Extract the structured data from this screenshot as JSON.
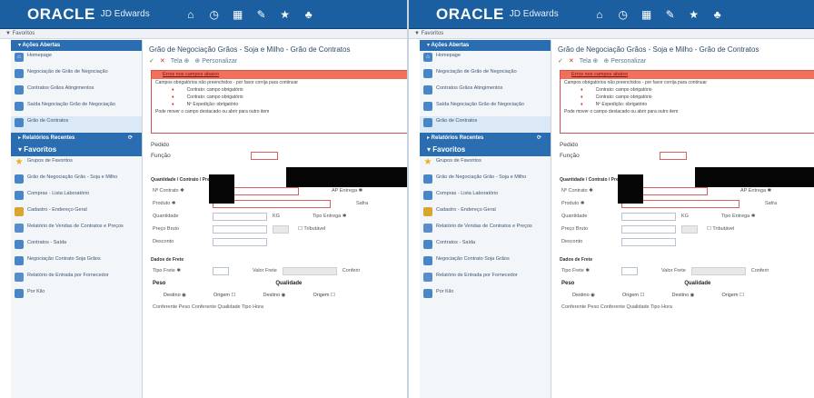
{
  "header": {
    "logo": "ORACLE",
    "logo_sub": "JD Edwards",
    "icons": [
      "home-icon",
      "clock-icon",
      "report-icon",
      "edit-icon",
      "star-icon",
      "bell-icon"
    ]
  },
  "favbar": {
    "label": "▼ Favoritos"
  },
  "sidebar": {
    "section_open": "▾ Ações Abertas",
    "open_items": [
      {
        "label": "Homepage",
        "icon": "home-icon"
      },
      {
        "label": "Negociação de Grão de Negociação",
        "icon": "app-icon"
      },
      {
        "label": "Contratos Grãos Atingimentos",
        "icon": "app-icon"
      },
      {
        "label": "Saída Negociação Grão de Negociação",
        "icon": "app-icon"
      },
      {
        "label": "Grão de Contratos",
        "icon": "app-icon",
        "active": true
      }
    ],
    "section_recent": "▸ Relatórios Recentes",
    "section_fav": "▾ Favoritos",
    "fav_items": [
      {
        "label": "Grupos de Favoritos",
        "icon": "star-icon"
      },
      {
        "label": "Grão de Negociação Grão - Soja e Milho",
        "icon": "app-icon"
      },
      {
        "label": "Compras - Lista Laboratório",
        "icon": "app-icon"
      },
      {
        "label": "Cadastro - Endereço Geral",
        "icon": "people-icon"
      },
      {
        "label": "Relatório de Vendas de Contratos e Preços",
        "icon": "doc-icon"
      },
      {
        "label": "Contratos - Saída",
        "icon": "app-icon"
      },
      {
        "label": "Negociação Contrato Soja Grãos",
        "icon": "app-icon"
      },
      {
        "label": "Relatório de Entrada por Fornecedor",
        "icon": "doc-icon"
      },
      {
        "label": "Por Kilo",
        "icon": "app-icon"
      }
    ]
  },
  "main": {
    "title": "Grão de Negociação Grãos - Soja e Milho - Grão de Contratos",
    "toolbar": {
      "ok": "✓",
      "cancel": "✕",
      "find": "Tela ⊕",
      "personalize": "⊕ Personalizar"
    },
    "error_box": {
      "head": "Erros nos campos abaixo",
      "intro": "Campos obrigatórios não preenchidos - por favor corrija para continuar",
      "errors": [
        "Contrato: campo obrigatório",
        "Contrato: campo obrigatório",
        "Nº Expedição: obrigatório"
      ],
      "foot": "Pode mover o campo destacado ou abrir para outro item"
    },
    "field_1": "Pedido",
    "field_2": "Função",
    "section_1": "Quantidade / Contrato / Preço / Desp.",
    "rows": [
      {
        "label": "Nº Contrato ✱",
        "right_label": "AP Entrega ✱"
      },
      {
        "label": "Produto ✱",
        "right_label": "Safra"
      },
      {
        "label": "Quantidade",
        "mid": "KG",
        "right_label": "Tipo Entrega ✱"
      },
      {
        "label": "Preço Bruto",
        "right_label": "Tributável"
      },
      {
        "label": "Desconto"
      }
    ],
    "section_2": "Dados de Frete",
    "frete_label": "Tipo Frete ✱",
    "frete_mid": "Valor Frete",
    "frete_right": "Conferir",
    "peso_label": "Peso",
    "qualidade_label": "Qualidade",
    "radio_1": "Destino ◉",
    "radio_2": "Origem ☐",
    "radio_3": "Destino ◉",
    "radio_4": "Origem ☐",
    "bottom": "Conferente Peso    Conferente Qualidade   Tipo Hora"
  }
}
